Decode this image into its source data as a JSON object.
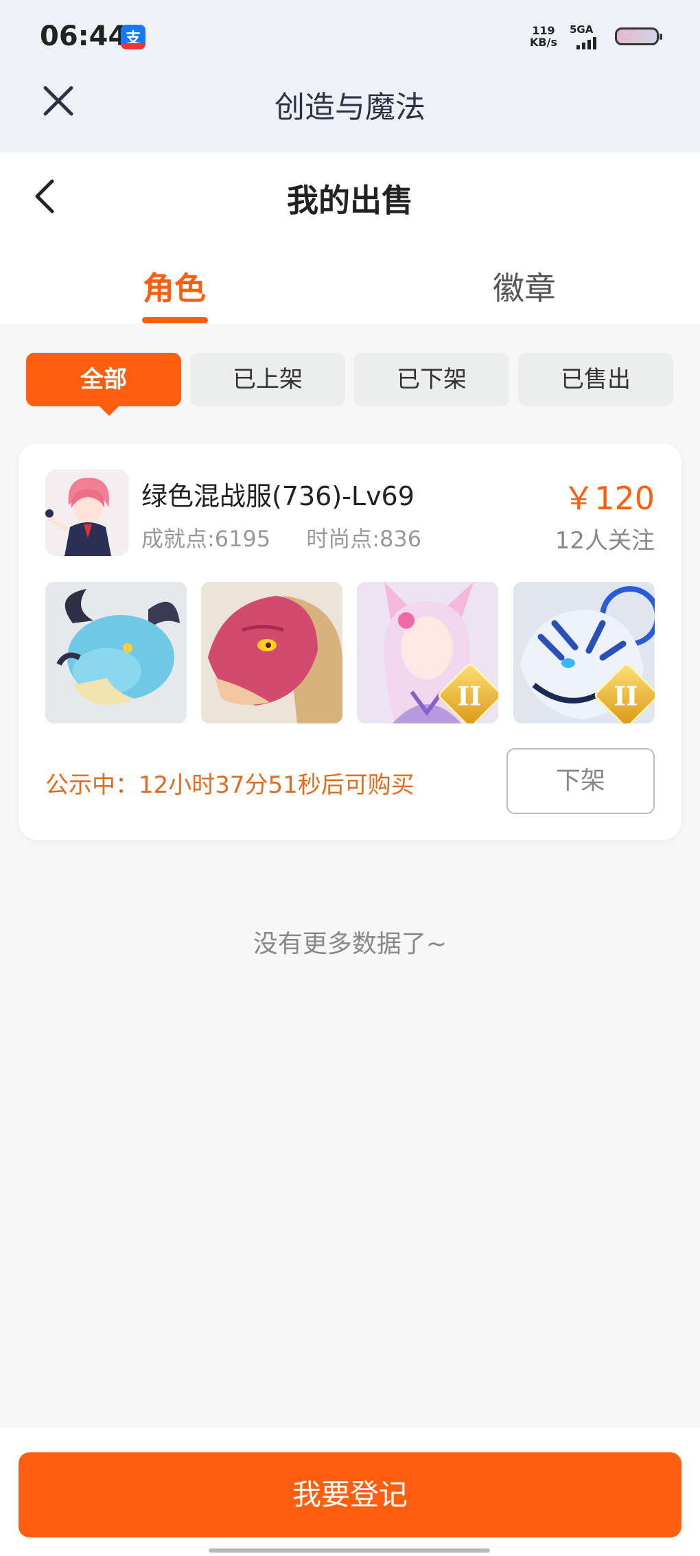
{
  "status_bar": {
    "time": "06:44",
    "net_speed_value": "119",
    "net_speed_unit": "KB/s",
    "network_type": "5GA",
    "app_icon": "alipay-icon",
    "app_icon_glyph": "支"
  },
  "app_bar": {
    "title": "创造与魔法",
    "close_icon": "close-icon"
  },
  "page_header": {
    "title": "我的出售",
    "back_icon": "back-chevron-icon"
  },
  "tabs": [
    {
      "label": "角色",
      "active": true
    },
    {
      "label": "徽章",
      "active": false
    }
  ],
  "filters": [
    {
      "label": "全部",
      "active": true
    },
    {
      "label": "已上架",
      "active": false
    },
    {
      "label": "已下架",
      "active": false
    },
    {
      "label": "已售出",
      "active": false
    }
  ],
  "listing": {
    "title": "绿色混战服(736)-Lv69",
    "achievement_points": "成就点:6195",
    "fashion_points": "时尚点:836",
    "price": "￥120",
    "followers": "12人关注",
    "thumbnails": [
      {
        "name": "blue-dragon-mount",
        "rank": ""
      },
      {
        "name": "red-dragon-mount",
        "rank": ""
      },
      {
        "name": "fox-spirit-character",
        "rank": "II"
      },
      {
        "name": "white-tiger-mount",
        "rank": "II"
      }
    ],
    "notice": "公示中：12小时37分51秒后可购买",
    "delist_label": "下架"
  },
  "no_more_text": "没有更多数据了~",
  "register_label": "我要登记",
  "colors": {
    "accent": "#ff5e0e",
    "notice": "#e56a1b",
    "header_bg": "#eef2f6",
    "page_bg": "#f7f7f8"
  }
}
